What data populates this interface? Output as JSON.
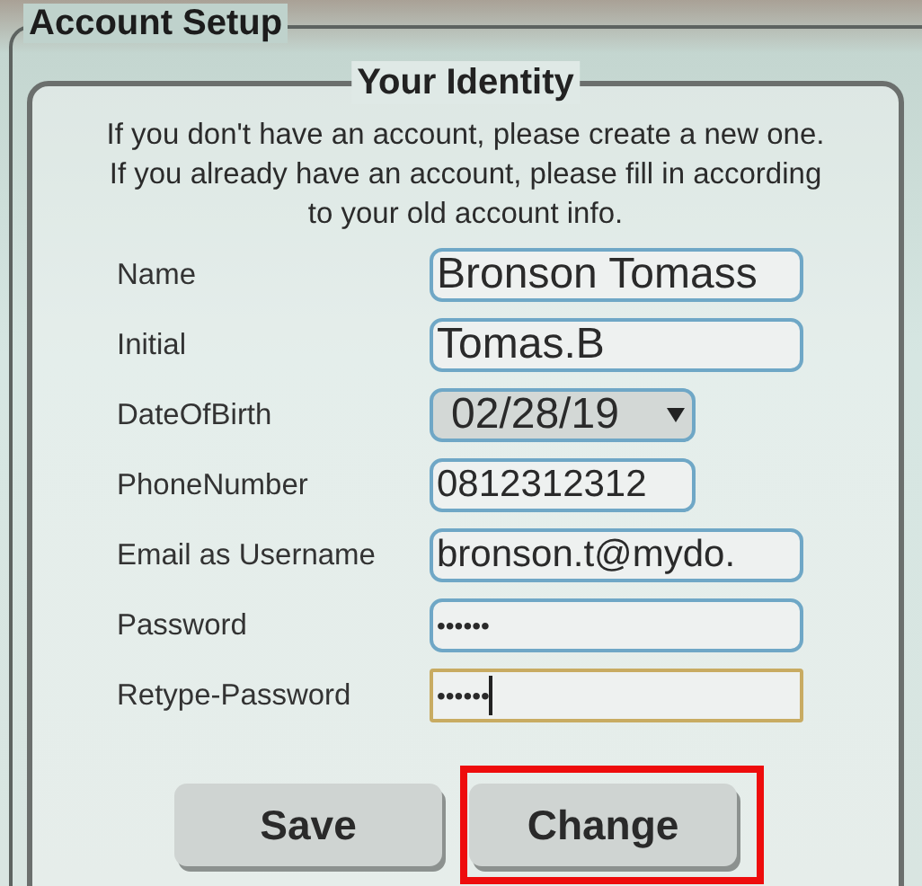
{
  "account_setup": {
    "title": "Account Setup",
    "identity": {
      "title": "Your Identity",
      "intro": "If you don't have an account, please create a new one. If you already have an account, please fill in according to your old account info.",
      "fields": [
        {
          "label": "Name",
          "kind": "text",
          "value": "Bronson Tomass",
          "focused": false
        },
        {
          "label": "Initial",
          "kind": "text",
          "value": "Tomas.B",
          "focused": false
        },
        {
          "label": "DateOfBirth",
          "kind": "date",
          "value": "02/28/19",
          "focused": false
        },
        {
          "label": "PhoneNumber",
          "kind": "number",
          "value": "0812312312",
          "focused": false
        },
        {
          "label": "Email as Username",
          "kind": "email",
          "value": "bronson.t@mydo.",
          "focused": false
        },
        {
          "label": "Password",
          "kind": "password",
          "value": "••••••",
          "focused": false
        },
        {
          "label": "Retype-Password",
          "kind": "password",
          "value": "••••••",
          "focused": true
        }
      ],
      "buttons": [
        {
          "label": "Save",
          "highlighted": false
        },
        {
          "label": "Change",
          "highlighted": true
        }
      ]
    }
  }
}
